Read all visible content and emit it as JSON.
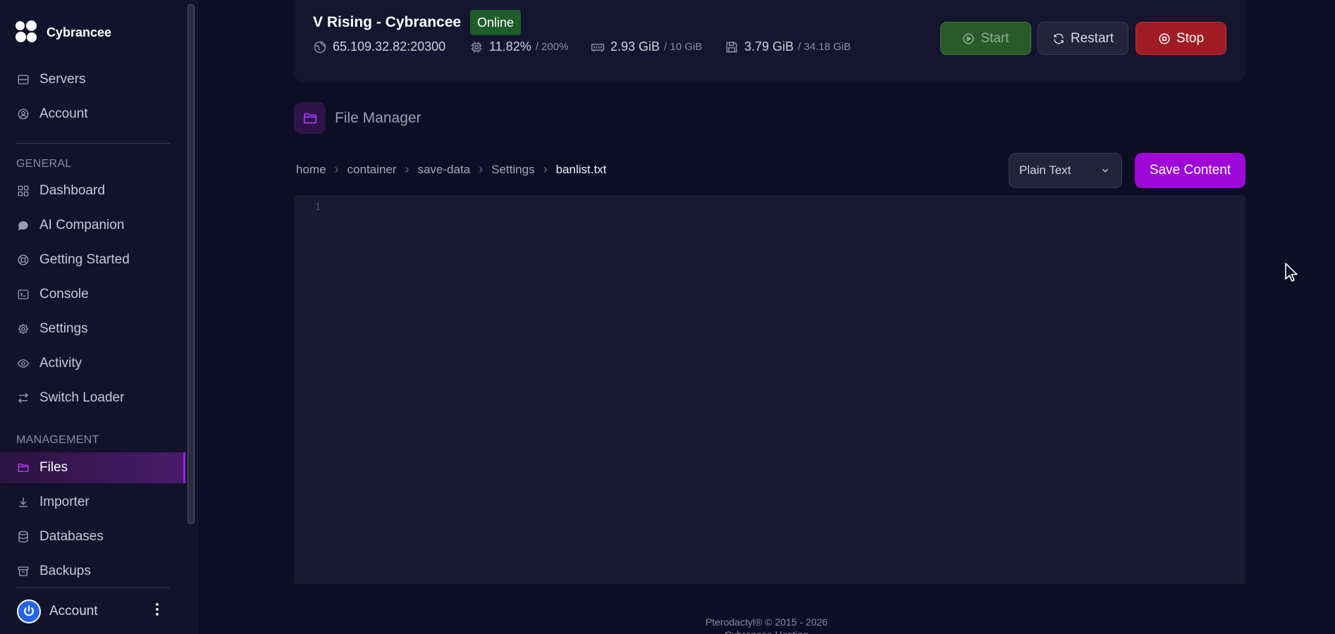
{
  "brand": {
    "name": "Cybrancee"
  },
  "nav": {
    "top": [
      {
        "label": "Servers",
        "icon": "server-icon"
      },
      {
        "label": "Account",
        "icon": "account-icon"
      }
    ],
    "general_label": "GENERAL",
    "general": [
      {
        "label": "Dashboard",
        "icon": "dashboard-icon"
      },
      {
        "label": "AI Companion",
        "icon": "chat-icon"
      },
      {
        "label": "Getting Started",
        "icon": "lifebuoy-icon"
      },
      {
        "label": "Console",
        "icon": "terminal-icon"
      },
      {
        "label": "Settings",
        "icon": "gear-icon"
      },
      {
        "label": "Activity",
        "icon": "eye-icon"
      },
      {
        "label": "Switch Loader",
        "icon": "swap-icon"
      }
    ],
    "management_label": "MANAGEMENT",
    "management": [
      {
        "label": "Files",
        "icon": "folder-icon",
        "active": true
      },
      {
        "label": "Importer",
        "icon": "download-icon"
      },
      {
        "label": "Databases",
        "icon": "database-icon"
      },
      {
        "label": "Backups",
        "icon": "archive-icon"
      }
    ],
    "account_label": "Account"
  },
  "server": {
    "name": "V Rising - Cybrancee",
    "status": "Online",
    "address": "65.109.32.82:20300",
    "cpu": "11.82%",
    "cpu_limit": "/ 200%",
    "memory": "2.93 GiB",
    "memory_limit": "/ 10 GiB",
    "disk": "3.79 GiB",
    "disk_limit": "/ 34.18 GiB",
    "buttons": {
      "start": "Start",
      "restart": "Restart",
      "stop": "Stop"
    }
  },
  "file_manager": {
    "title": "File Manager",
    "breadcrumb": [
      "home",
      "container",
      "save-data",
      "Settings",
      "banlist.txt"
    ],
    "language": "Plain Text",
    "save_label": "Save Content",
    "editor": {
      "line_numbers": [
        "1"
      ]
    }
  },
  "footer": {
    "line1": "Pterodactyl® © 2015 - 2026",
    "line2": "Cybrancee Hosting"
  },
  "colors": {
    "accent": "#9d08d8",
    "online": "#1f5d2a",
    "stop": "#a01c24",
    "start": "#2a5a2a"
  }
}
